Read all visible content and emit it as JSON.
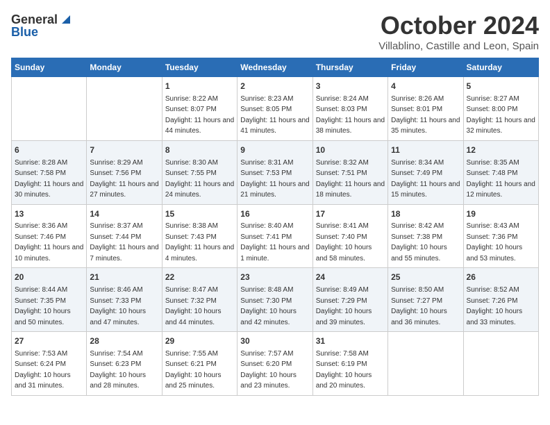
{
  "header": {
    "logo_general": "General",
    "logo_blue": "Blue",
    "month_title": "October 2024",
    "location": "Villablino, Castille and Leon, Spain"
  },
  "weekdays": [
    "Sunday",
    "Monday",
    "Tuesday",
    "Wednesday",
    "Thursday",
    "Friday",
    "Saturday"
  ],
  "weeks": [
    [
      {
        "day": "",
        "sunrise": "",
        "sunset": "",
        "daylight": ""
      },
      {
        "day": "",
        "sunrise": "",
        "sunset": "",
        "daylight": ""
      },
      {
        "day": "1",
        "sunrise": "Sunrise: 8:22 AM",
        "sunset": "Sunset: 8:07 PM",
        "daylight": "Daylight: 11 hours and 44 minutes."
      },
      {
        "day": "2",
        "sunrise": "Sunrise: 8:23 AM",
        "sunset": "Sunset: 8:05 PM",
        "daylight": "Daylight: 11 hours and 41 minutes."
      },
      {
        "day": "3",
        "sunrise": "Sunrise: 8:24 AM",
        "sunset": "Sunset: 8:03 PM",
        "daylight": "Daylight: 11 hours and 38 minutes."
      },
      {
        "day": "4",
        "sunrise": "Sunrise: 8:26 AM",
        "sunset": "Sunset: 8:01 PM",
        "daylight": "Daylight: 11 hours and 35 minutes."
      },
      {
        "day": "5",
        "sunrise": "Sunrise: 8:27 AM",
        "sunset": "Sunset: 8:00 PM",
        "daylight": "Daylight: 11 hours and 32 minutes."
      }
    ],
    [
      {
        "day": "6",
        "sunrise": "Sunrise: 8:28 AM",
        "sunset": "Sunset: 7:58 PM",
        "daylight": "Daylight: 11 hours and 30 minutes."
      },
      {
        "day": "7",
        "sunrise": "Sunrise: 8:29 AM",
        "sunset": "Sunset: 7:56 PM",
        "daylight": "Daylight: 11 hours and 27 minutes."
      },
      {
        "day": "8",
        "sunrise": "Sunrise: 8:30 AM",
        "sunset": "Sunset: 7:55 PM",
        "daylight": "Daylight: 11 hours and 24 minutes."
      },
      {
        "day": "9",
        "sunrise": "Sunrise: 8:31 AM",
        "sunset": "Sunset: 7:53 PM",
        "daylight": "Daylight: 11 hours and 21 minutes."
      },
      {
        "day": "10",
        "sunrise": "Sunrise: 8:32 AM",
        "sunset": "Sunset: 7:51 PM",
        "daylight": "Daylight: 11 hours and 18 minutes."
      },
      {
        "day": "11",
        "sunrise": "Sunrise: 8:34 AM",
        "sunset": "Sunset: 7:49 PM",
        "daylight": "Daylight: 11 hours and 15 minutes."
      },
      {
        "day": "12",
        "sunrise": "Sunrise: 8:35 AM",
        "sunset": "Sunset: 7:48 PM",
        "daylight": "Daylight: 11 hours and 12 minutes."
      }
    ],
    [
      {
        "day": "13",
        "sunrise": "Sunrise: 8:36 AM",
        "sunset": "Sunset: 7:46 PM",
        "daylight": "Daylight: 11 hours and 10 minutes."
      },
      {
        "day": "14",
        "sunrise": "Sunrise: 8:37 AM",
        "sunset": "Sunset: 7:44 PM",
        "daylight": "Daylight: 11 hours and 7 minutes."
      },
      {
        "day": "15",
        "sunrise": "Sunrise: 8:38 AM",
        "sunset": "Sunset: 7:43 PM",
        "daylight": "Daylight: 11 hours and 4 minutes."
      },
      {
        "day": "16",
        "sunrise": "Sunrise: 8:40 AM",
        "sunset": "Sunset: 7:41 PM",
        "daylight": "Daylight: 11 hours and 1 minute."
      },
      {
        "day": "17",
        "sunrise": "Sunrise: 8:41 AM",
        "sunset": "Sunset: 7:40 PM",
        "daylight": "Daylight: 10 hours and 58 minutes."
      },
      {
        "day": "18",
        "sunrise": "Sunrise: 8:42 AM",
        "sunset": "Sunset: 7:38 PM",
        "daylight": "Daylight: 10 hours and 55 minutes."
      },
      {
        "day": "19",
        "sunrise": "Sunrise: 8:43 AM",
        "sunset": "Sunset: 7:36 PM",
        "daylight": "Daylight: 10 hours and 53 minutes."
      }
    ],
    [
      {
        "day": "20",
        "sunrise": "Sunrise: 8:44 AM",
        "sunset": "Sunset: 7:35 PM",
        "daylight": "Daylight: 10 hours and 50 minutes."
      },
      {
        "day": "21",
        "sunrise": "Sunrise: 8:46 AM",
        "sunset": "Sunset: 7:33 PM",
        "daylight": "Daylight: 10 hours and 47 minutes."
      },
      {
        "day": "22",
        "sunrise": "Sunrise: 8:47 AM",
        "sunset": "Sunset: 7:32 PM",
        "daylight": "Daylight: 10 hours and 44 minutes."
      },
      {
        "day": "23",
        "sunrise": "Sunrise: 8:48 AM",
        "sunset": "Sunset: 7:30 PM",
        "daylight": "Daylight: 10 hours and 42 minutes."
      },
      {
        "day": "24",
        "sunrise": "Sunrise: 8:49 AM",
        "sunset": "Sunset: 7:29 PM",
        "daylight": "Daylight: 10 hours and 39 minutes."
      },
      {
        "day": "25",
        "sunrise": "Sunrise: 8:50 AM",
        "sunset": "Sunset: 7:27 PM",
        "daylight": "Daylight: 10 hours and 36 minutes."
      },
      {
        "day": "26",
        "sunrise": "Sunrise: 8:52 AM",
        "sunset": "Sunset: 7:26 PM",
        "daylight": "Daylight: 10 hours and 33 minutes."
      }
    ],
    [
      {
        "day": "27",
        "sunrise": "Sunrise: 7:53 AM",
        "sunset": "Sunset: 6:24 PM",
        "daylight": "Daylight: 10 hours and 31 minutes."
      },
      {
        "day": "28",
        "sunrise": "Sunrise: 7:54 AM",
        "sunset": "Sunset: 6:23 PM",
        "daylight": "Daylight: 10 hours and 28 minutes."
      },
      {
        "day": "29",
        "sunrise": "Sunrise: 7:55 AM",
        "sunset": "Sunset: 6:21 PM",
        "daylight": "Daylight: 10 hours and 25 minutes."
      },
      {
        "day": "30",
        "sunrise": "Sunrise: 7:57 AM",
        "sunset": "Sunset: 6:20 PM",
        "daylight": "Daylight: 10 hours and 23 minutes."
      },
      {
        "day": "31",
        "sunrise": "Sunrise: 7:58 AM",
        "sunset": "Sunset: 6:19 PM",
        "daylight": "Daylight: 10 hours and 20 minutes."
      },
      {
        "day": "",
        "sunrise": "",
        "sunset": "",
        "daylight": ""
      },
      {
        "day": "",
        "sunrise": "",
        "sunset": "",
        "daylight": ""
      }
    ]
  ]
}
